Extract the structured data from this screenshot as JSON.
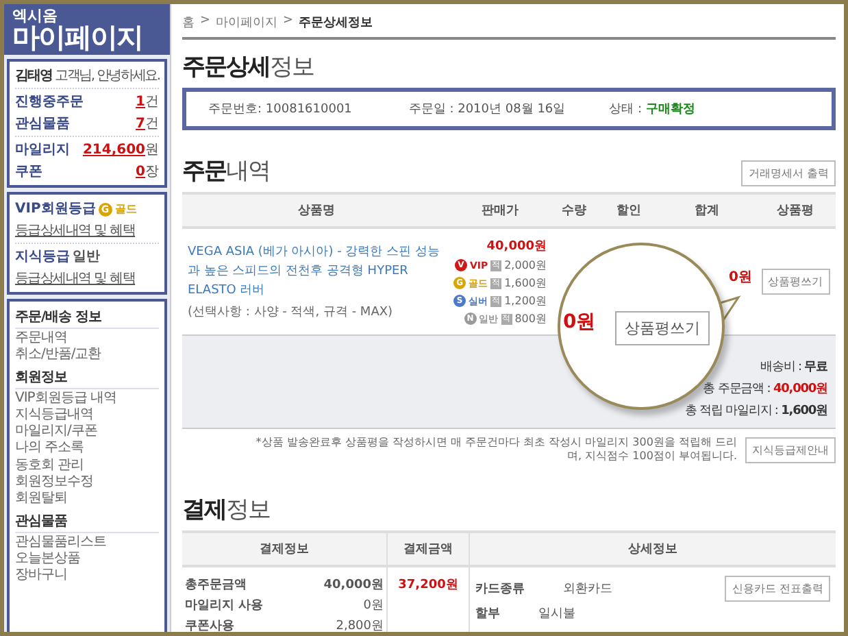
{
  "sidebar": {
    "brand_small": "엑시옴",
    "brand": "마이페이지",
    "user": {
      "name": "김태영",
      "greeting": "고객님, 안녕하세요."
    },
    "stats": [
      {
        "label": "진행중주문",
        "value": "1",
        "unit": "건"
      },
      {
        "label": "관심물품",
        "value": "7",
        "unit": "건"
      },
      {
        "label": "마일리지",
        "value": "214,600",
        "unit": "원"
      },
      {
        "label": "쿠폰",
        "value": "0",
        "unit": "장"
      }
    ],
    "grade": {
      "vip_label": "VIP회원등급",
      "badge_letter": "G",
      "badge": "골드",
      "vip_link": "등급상세내역 및 혜택",
      "knowledge_label": "지식등급",
      "knowledge_value": "일반",
      "knowledge_link": "등급상세내역 및 혜택"
    },
    "menus": [
      {
        "title": "주문/배송 정보",
        "items": [
          "주문내역",
          "취소/반품/교환"
        ]
      },
      {
        "title": "회원정보",
        "items": [
          "VIP회원등급 내역",
          "지식등급내역",
          "마일리지/쿠폰",
          "나의 주소록",
          "동호회 관리",
          "회원정보수정",
          "회원탈퇴"
        ]
      },
      {
        "title": "관심물품",
        "items": [
          "관심물품리스트",
          "오늘본상품",
          "장바구니"
        ]
      }
    ]
  },
  "breadcrumb": {
    "items": [
      "홈",
      "마이페이지",
      "주문상세정보"
    ],
    "separator": ">"
  },
  "page_title": {
    "bold": "주문상세",
    "light": "정보"
  },
  "order_info": [
    {
      "label": "주문번호:",
      "value": "10081610001",
      "highlight": false
    },
    {
      "label": "주문일 :",
      "value": "2010년 08월 16일",
      "highlight": false
    },
    {
      "label": "상태 :",
      "value": "구매확정",
      "highlight": true
    }
  ],
  "order": {
    "title_bold": "주문",
    "title_light": "내역",
    "print_button": "거래명세서 출력",
    "columns": [
      "상품명",
      "판매가",
      "수량",
      "할인",
      "합계",
      "상품평"
    ],
    "row": {
      "product": "VEGA ASIA (베가 아시아) - 강력한 스핀 성능과 높은 스피드의 전천후 공격형 HYPER ELASTO 러버",
      "option": "(선택사항 : 사양 - 적색, 규격 - MAX)",
      "price": "40,000원",
      "tiers": [
        {
          "letter": "V",
          "label": "VIP",
          "mark": "적",
          "amount": "2,000원",
          "color": "#cc1a1a"
        },
        {
          "letter": "G",
          "label": "골드",
          "mark": "적",
          "amount": "1,600원",
          "color": "#d9a400"
        },
        {
          "letter": "S",
          "label": "실버",
          "mark": "적",
          "amount": "1,200원",
          "color": "#4a7ac8"
        },
        {
          "letter": "N",
          "label": "일반",
          "mark": "적",
          "amount": "800원",
          "color": "#999999"
        }
      ],
      "sum": "0원",
      "review_button": "상품평쓰기"
    },
    "summary": [
      {
        "label": "배송비 :",
        "value": "무료",
        "highlight": false
      },
      {
        "label": "총 주문금액 :",
        "value": "40,000원",
        "highlight": true
      },
      {
        "label": "총 적립 마일리지 :",
        "value": "1,600원",
        "highlight": false
      }
    ],
    "note": "*상품 발송완료후 상품평을 작성하시면 매 주문건마다 최초 작성시 마일리지 300원을 적립해 드리며, 지식점수 100점이 부여됩니다.",
    "note_button": "지식등급제안내"
  },
  "magnifier": {
    "partial_amount": "0원",
    "button": "상품평쓰기"
  },
  "payment": {
    "title_bold": "결제",
    "title_light": "정보",
    "columns": [
      "결제정보",
      "결제금액",
      "상세정보"
    ],
    "items": [
      {
        "label": "총주문금액",
        "value": "40,000원",
        "bold": true
      },
      {
        "label": "마일리지 사용",
        "value": "0원",
        "bold": false
      },
      {
        "label": "쿠폰사용",
        "value": "2,800원",
        "bold": false
      }
    ],
    "amount": "37,200원",
    "details": [
      {
        "label": "카드종류",
        "value": "외환카드"
      },
      {
        "label": "할부",
        "value": "일시불"
      }
    ],
    "receipt_button": "신용카드 전표출력"
  }
}
